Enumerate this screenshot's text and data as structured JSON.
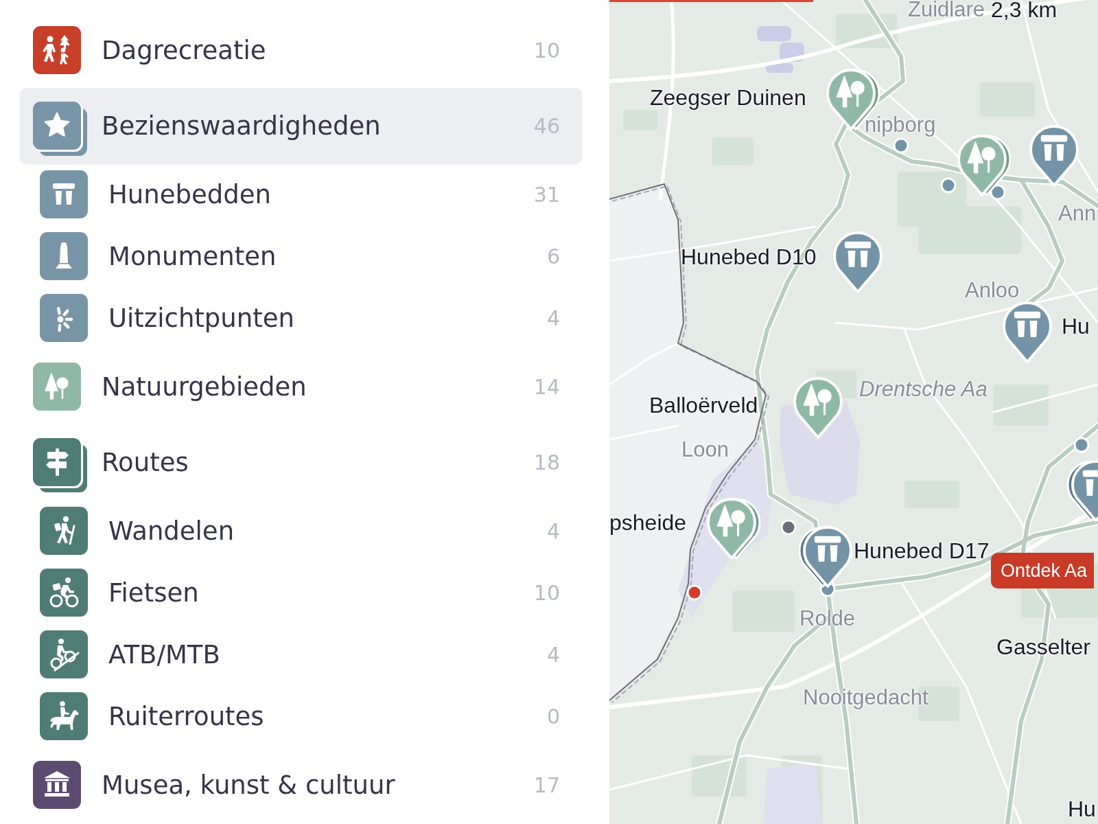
{
  "categories": [
    {
      "label": "Dagrecreatie",
      "count": "10",
      "color": "#c83f29",
      "selected": false
    },
    {
      "label": "Bezienswaardigheden",
      "count": "46",
      "color": "#7895a7",
      "selected": true,
      "children": [
        {
          "label": "Hunebedden",
          "count": "31",
          "selected": false
        },
        {
          "label": "Monumenten",
          "count": "6",
          "selected": false
        },
        {
          "label": "Uitzichtpunten",
          "count": "4",
          "selected": false
        }
      ]
    },
    {
      "label": "Natuurgebieden",
      "count": "14",
      "color": "#8fb9a6",
      "selected": false
    },
    {
      "label": "Routes",
      "count": "18",
      "color": "#4f7c74",
      "selected": false,
      "children": [
        {
          "label": "Wandelen",
          "count": "4",
          "selected": false
        },
        {
          "label": "Fietsen",
          "count": "10",
          "selected": false
        },
        {
          "label": "ATB/MTB",
          "count": "4",
          "selected": false
        },
        {
          "label": "Ruiterroutes",
          "count": "0",
          "selected": false
        }
      ]
    },
    {
      "label": "Musea, kunst & cultuur",
      "count": "17",
      "color": "#5c4a70",
      "selected": false
    }
  ],
  "map": {
    "labels": [
      {
        "text": "Zuidlare",
        "kind": "place"
      },
      {
        "text": "2,3 km",
        "kind": "poi"
      },
      {
        "text": "Zeegser Duinen",
        "kind": "poi"
      },
      {
        "text": "nipborg",
        "kind": "place"
      },
      {
        "text": "Ann",
        "kind": "place"
      },
      {
        "text": "Hunebed D10",
        "kind": "poi"
      },
      {
        "text": "Anloo",
        "kind": "place"
      },
      {
        "text": "Hu",
        "kind": "poi"
      },
      {
        "text": "Drentsche Aa",
        "kind": "water"
      },
      {
        "text": "Balloërveld",
        "kind": "poi"
      },
      {
        "text": "Loon",
        "kind": "place"
      },
      {
        "text": "psheide",
        "kind": "poi"
      },
      {
        "text": "Hunebed D17",
        "kind": "poi"
      },
      {
        "text": "Rolde",
        "kind": "place"
      },
      {
        "text": "Gasselter",
        "kind": "poi"
      },
      {
        "text": "Nooitgedacht",
        "kind": "place"
      },
      {
        "text": "Hu",
        "kind": "poi"
      }
    ],
    "markers": [
      {
        "kind": "nature",
        "stacked": true
      },
      {
        "kind": "dolmen",
        "stacked": false
      },
      {
        "kind": "nature",
        "stacked": true
      },
      {
        "kind": "dolmen",
        "stacked": false
      },
      {
        "kind": "dolmen",
        "stacked": false
      },
      {
        "kind": "nature",
        "stacked": false
      },
      {
        "kind": "dolmen",
        "stacked": true
      },
      {
        "kind": "nature",
        "stacked": true
      },
      {
        "kind": "dolmen",
        "stacked": true
      }
    ],
    "dots": [
      {
        "color": "#7393a7"
      },
      {
        "color": "#7393a7"
      },
      {
        "color": "#7393a7"
      },
      {
        "color": "#7393a7"
      },
      {
        "color": "#6b6e78"
      },
      {
        "color": "#7393a7"
      },
      {
        "color": "#d13b27"
      }
    ],
    "button": {
      "label": "Ontdek Aa"
    }
  }
}
